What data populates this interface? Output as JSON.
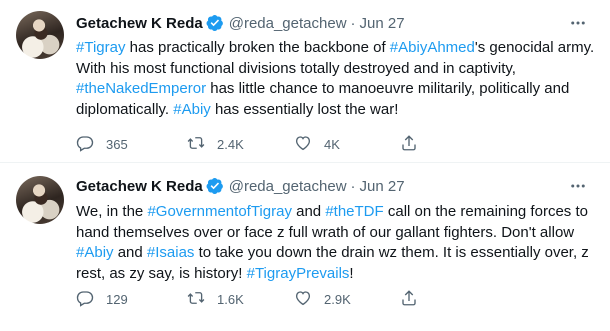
{
  "tweets": [
    {
      "author": "Getachew K Reda",
      "handle": "@reda_getachew",
      "separator": "·",
      "date": "Jun 27",
      "text": [
        {
          "t": "#Tigray",
          "tag": true
        },
        {
          "t": " has practically  broken the backbone of ",
          "tag": false
        },
        {
          "t": "#AbiyAhmed",
          "tag": true
        },
        {
          "t": "'s genocidal army. With his most functional divisions totally destroyed and in captivity, ",
          "tag": false
        },
        {
          "t": "#theNakedEmperor",
          "tag": true
        },
        {
          "t": " has little chance to manoeuvre militarily, politically and diplomatically. ",
          "tag": false
        },
        {
          "t": "#Abiy",
          "tag": true
        },
        {
          "t": " has essentially lost the war!",
          "tag": false
        }
      ],
      "replies": "365",
      "retweets": "2.4K",
      "likes": "4K"
    },
    {
      "author": "Getachew K Reda",
      "handle": "@reda_getachew",
      "separator": "·",
      "date": "Jun 27",
      "text": [
        {
          "t": "We, in the ",
          "tag": false
        },
        {
          "t": "#GovernmentofTigray",
          "tag": true
        },
        {
          "t": " and ",
          "tag": false
        },
        {
          "t": "#theTDF",
          "tag": true
        },
        {
          "t": " call on the remaining forces to hand themselves over or face z full wrath of our gallant fighters. Don't allow ",
          "tag": false
        },
        {
          "t": "#Abiy",
          "tag": true
        },
        {
          "t": " and ",
          "tag": false
        },
        {
          "t": "#Isaias",
          "tag": true
        },
        {
          "t": " to take you down the drain wz them. It is essentially over, z rest, as zy say, is history! ",
          "tag": false
        },
        {
          "t": "#TigrayPrevails",
          "tag": true
        },
        {
          "t": "!",
          "tag": false
        }
      ],
      "replies": "129",
      "retweets": "1.6K",
      "likes": "2.9K"
    }
  ],
  "more_icon": "more-horizontal-icon",
  "colors": {
    "link": "#1d9bf0",
    "verified": "#1d9bf0",
    "secondary": "#536471",
    "text": "#0f1419"
  }
}
